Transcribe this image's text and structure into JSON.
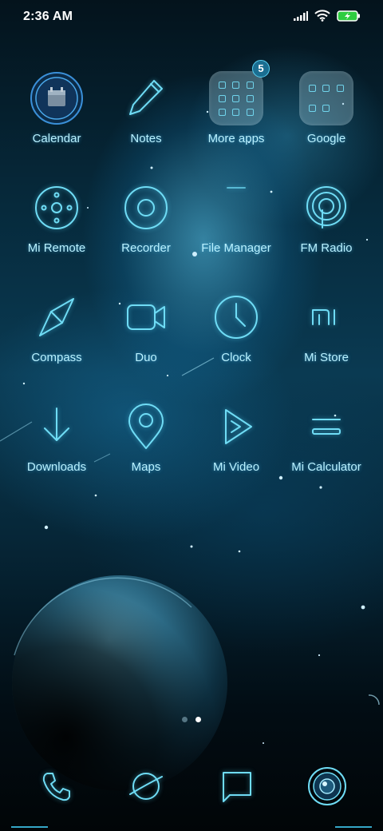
{
  "status_bar": {
    "time": "2:36 AM",
    "signal_icon": "signal-icon",
    "wifi_icon": "wifi-icon",
    "battery_icon": "battery-charging-icon"
  },
  "apps": [
    {
      "label": "Calendar",
      "icon": "calendar-icon"
    },
    {
      "label": "Notes",
      "icon": "pencil-icon"
    },
    {
      "label": "More apps",
      "icon": "folder-icon",
      "badge": "5"
    },
    {
      "label": "Google",
      "icon": "folder-icon"
    },
    {
      "label": "Mi Remote",
      "icon": "remote-icon"
    },
    {
      "label": "Recorder",
      "icon": "record-icon"
    },
    {
      "label": "File Manager",
      "icon": "file-manager-icon"
    },
    {
      "label": "FM Radio",
      "icon": "radio-icon"
    },
    {
      "label": "Compass",
      "icon": "compass-icon"
    },
    {
      "label": "Duo",
      "icon": "video-camera-icon"
    },
    {
      "label": "Clock",
      "icon": "clock-icon"
    },
    {
      "label": "Mi Store",
      "icon": "mi-logo-icon"
    },
    {
      "label": "Downloads",
      "icon": "download-icon"
    },
    {
      "label": "Maps",
      "icon": "map-pin-icon"
    },
    {
      "label": "Mi Video",
      "icon": "play-icon"
    },
    {
      "label": "Mi Calculator",
      "icon": "calculator-icon"
    }
  ],
  "page_indicator": {
    "pages": 2,
    "current": 2
  },
  "dock": [
    {
      "icon": "phone-icon"
    },
    {
      "icon": "browser-planet-icon"
    },
    {
      "icon": "messages-icon"
    },
    {
      "icon": "camera-icon"
    }
  ],
  "colors": {
    "accent": "#6fdcf5",
    "label": "#b9f1ff",
    "badge": "#1a6e91"
  }
}
